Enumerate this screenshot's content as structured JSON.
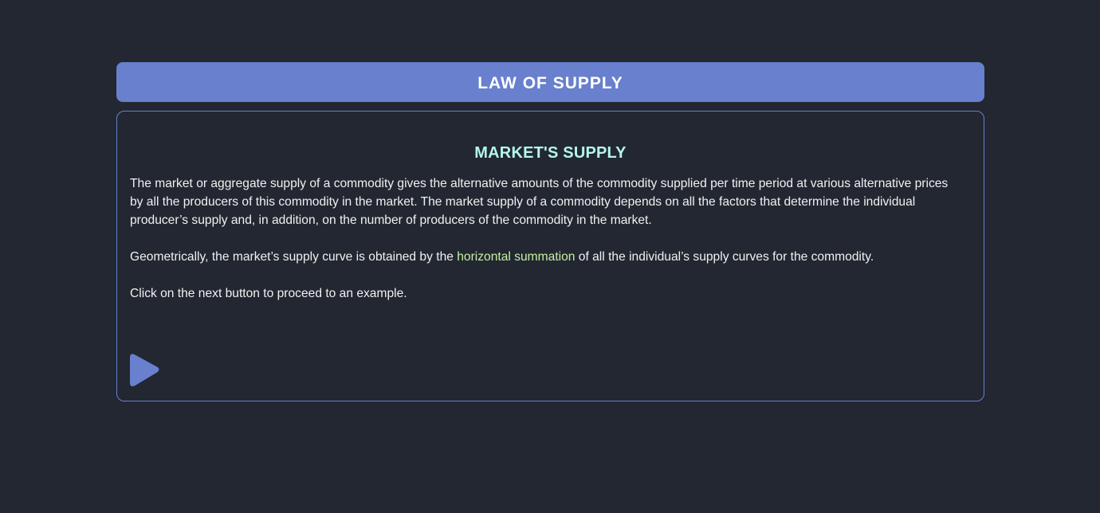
{
  "header": {
    "title": "LAW OF SUPPLY"
  },
  "content": {
    "section_title": "MARKET'S SUPPLY",
    "paragraph_1": "The market or aggregate supply of a commodity gives the alternative amounts of the commodity supplied per time period at various alternative prices by all the producers of this commodity in the market. The market supply of a commodity depends on all the factors that determine the individual producer’s supply and, in addition, on the number of producers of the commodity in the market.",
    "paragraph_2_before": "Geometrically, the market’s supply curve is obtained by the ",
    "paragraph_2_highlight": "horizontal summation",
    "paragraph_2_after": " of all the individual’s supply curves for the commodity.",
    "paragraph_3": "Click on the next button to proceed to an example.",
    "next_button_icon": "play-icon"
  },
  "colors": {
    "background": "#222731",
    "accent": "#6880cd",
    "title": "#b5f7e8",
    "highlight": "#c7f0a3",
    "text": "#f1f1f1"
  }
}
